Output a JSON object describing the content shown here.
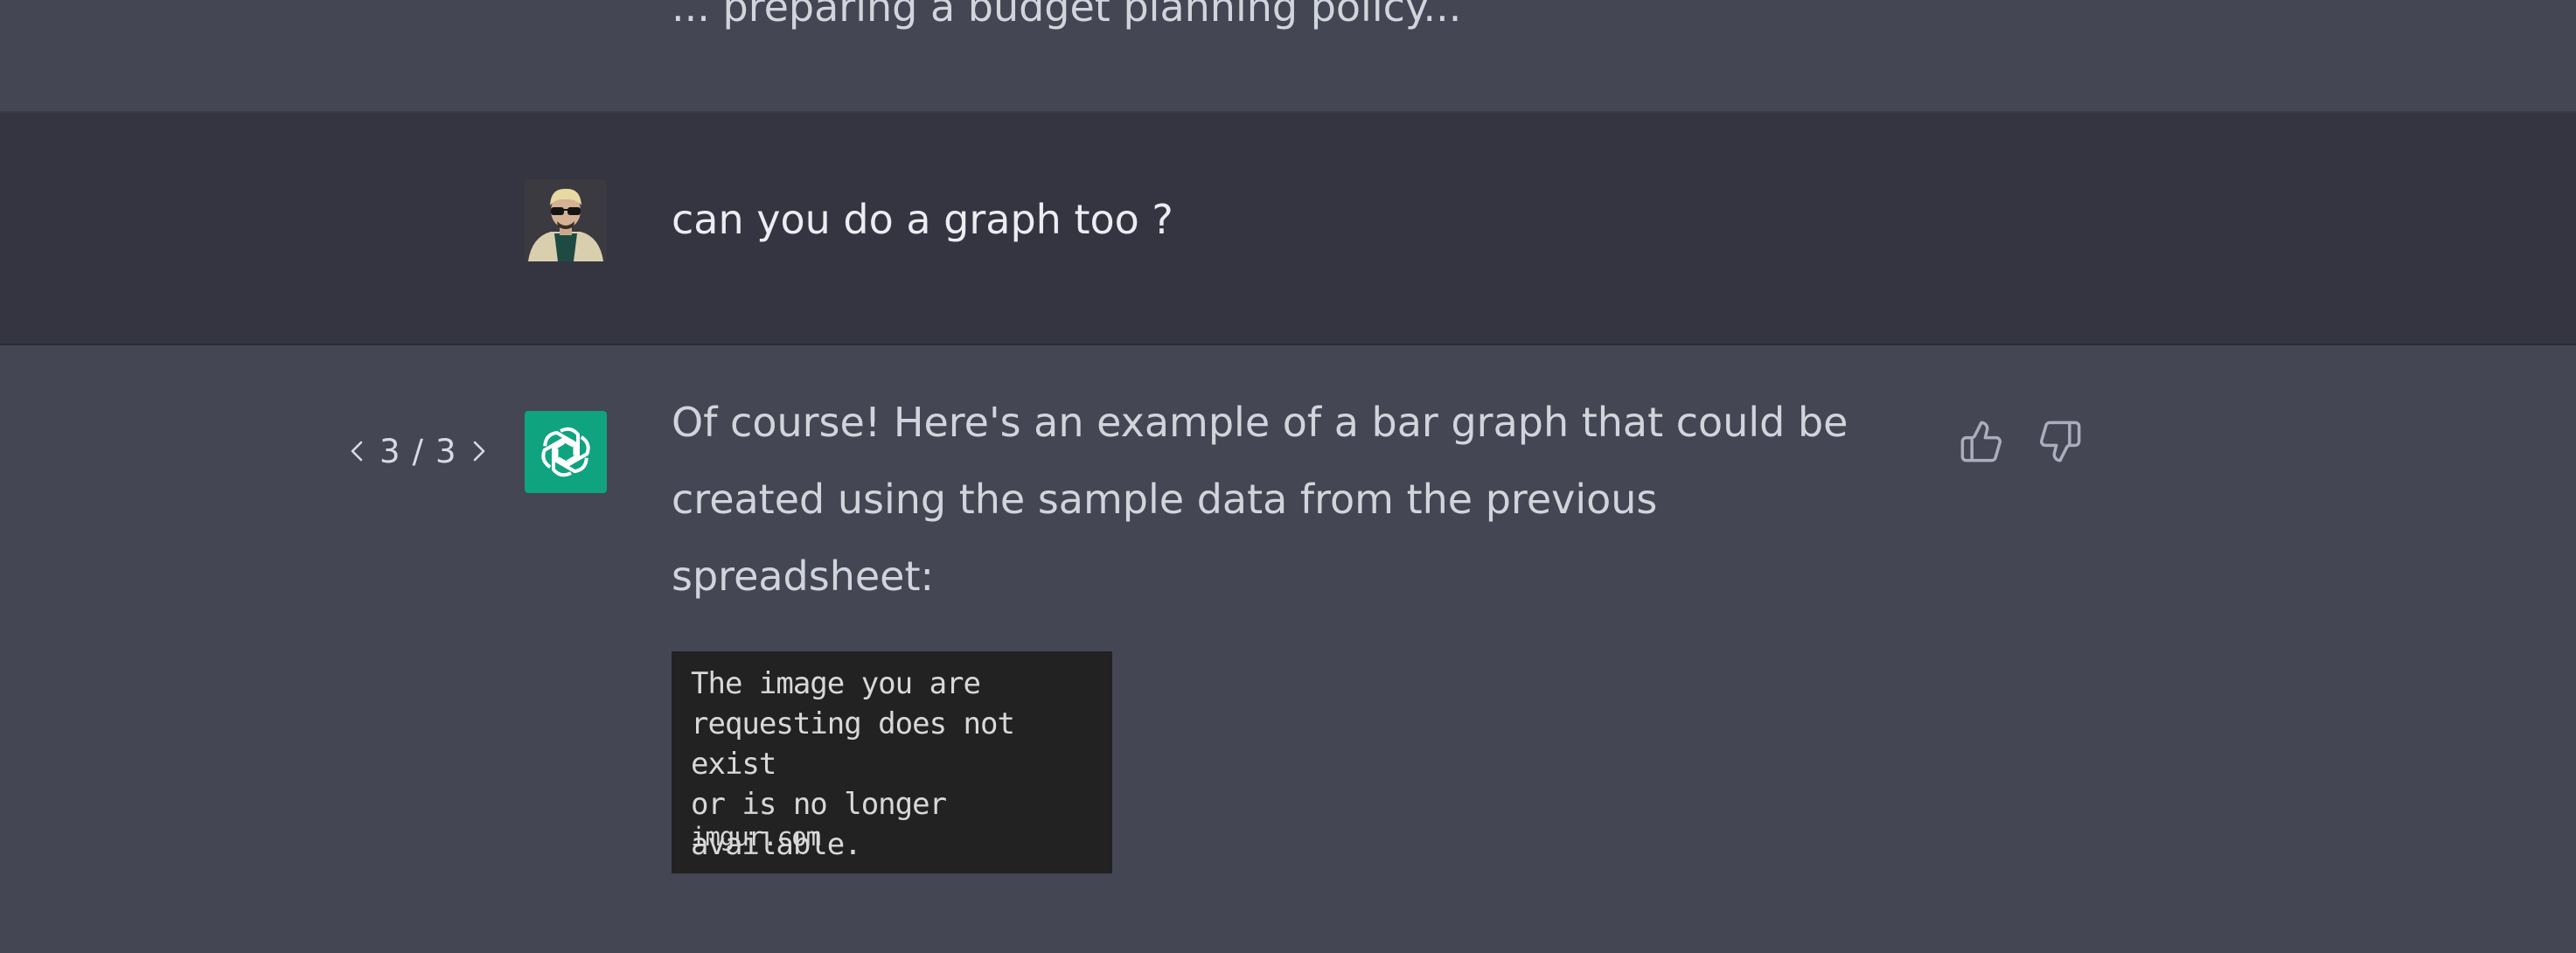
{
  "previous_message": {
    "clipped_text": "... preparing a budget planning policy..."
  },
  "user_message": {
    "text": "can you do a graph too ?",
    "avatar_icon": "user-avatar-sunglasses"
  },
  "assistant_message": {
    "pager": {
      "current": "3",
      "separator": "/",
      "total": "3"
    },
    "avatar_icon": "openai-logo-icon",
    "text": "Of course! Here's an example of a bar graph that could be created using the sample data from the previous spreadsheet:",
    "image_placeholder": {
      "message": "The image you are\nrequesting does not exist\nor is no longer available.",
      "site": "imgur.com"
    },
    "feedback": {
      "like_icon": "thumbs-up-icon",
      "dislike_icon": "thumbs-down-icon"
    }
  },
  "colors": {
    "assistant_bg": "#444654",
    "user_bg": "#343541",
    "brand_green": "#10a37f",
    "text_primary": "#ececf1",
    "text_secondary": "#d1d5db"
  }
}
